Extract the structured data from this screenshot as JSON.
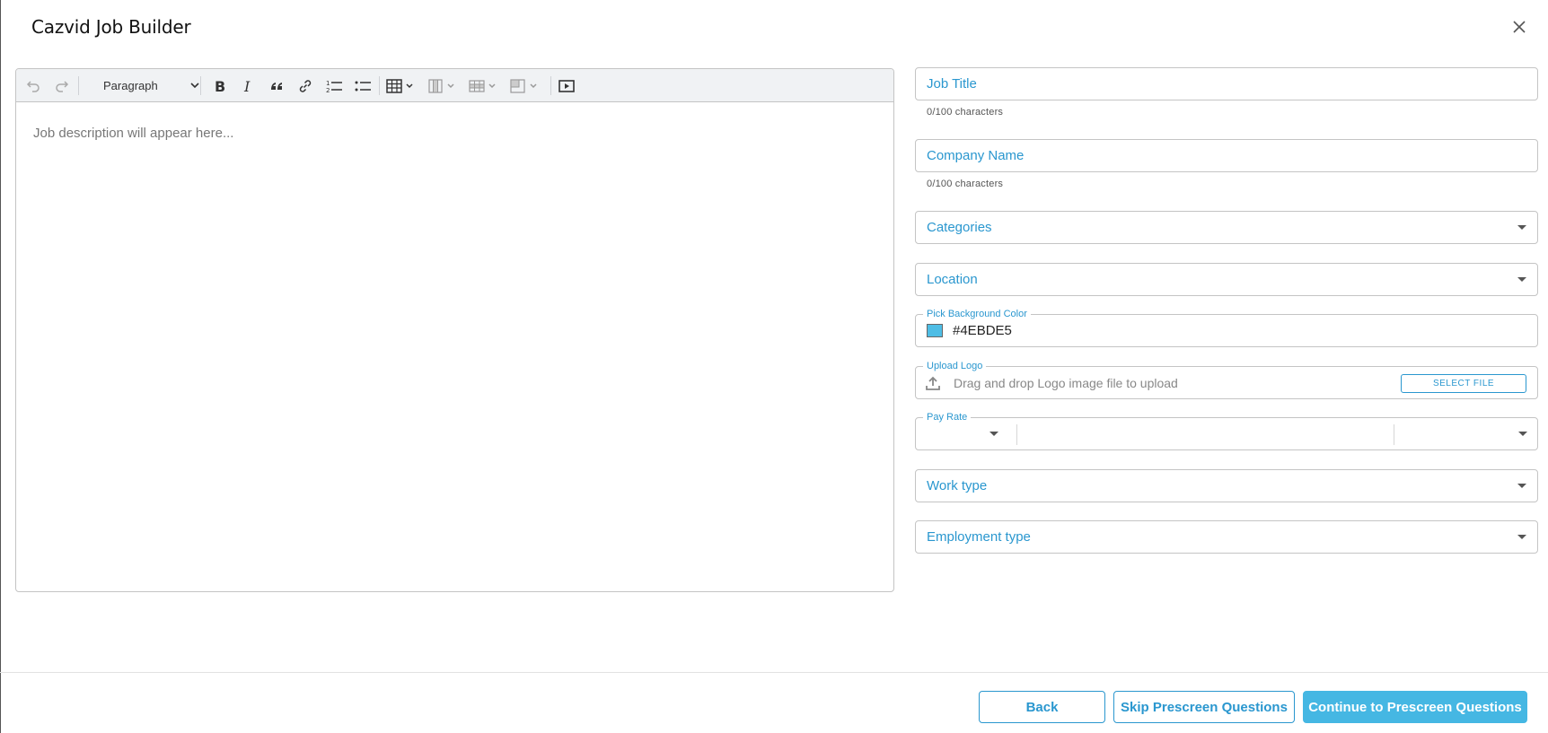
{
  "dialog": {
    "title": "Cazvid Job Builder"
  },
  "editor": {
    "heading_select": "Paragraph",
    "placeholder": "Job description will appear here..."
  },
  "form": {
    "job_title": {
      "placeholder": "Job Title",
      "counter": "0/100 characters"
    },
    "company_name": {
      "placeholder": "Company Name",
      "counter": "0/100 characters"
    },
    "categories": {
      "placeholder": "Categories"
    },
    "location": {
      "placeholder": "Location"
    },
    "background_color": {
      "label": "Pick Background Color",
      "value": "#4EBDE5",
      "swatch": "#4ebde5"
    },
    "upload_logo": {
      "label": "Upload Logo",
      "hint": "Drag and drop Logo image file to upload",
      "button": "SELECT FILE"
    },
    "pay_rate": {
      "label": "Pay Rate"
    },
    "work_type": {
      "placeholder": "Work type"
    },
    "employment_type": {
      "placeholder": "Employment type"
    }
  },
  "footer": {
    "back": "Back",
    "skip": "Skip Prescreen Questions",
    "continue": "Continue to Prescreen Questions"
  },
  "colors": {
    "accent": "#2a97cf",
    "primary_button": "#45b7e3"
  }
}
